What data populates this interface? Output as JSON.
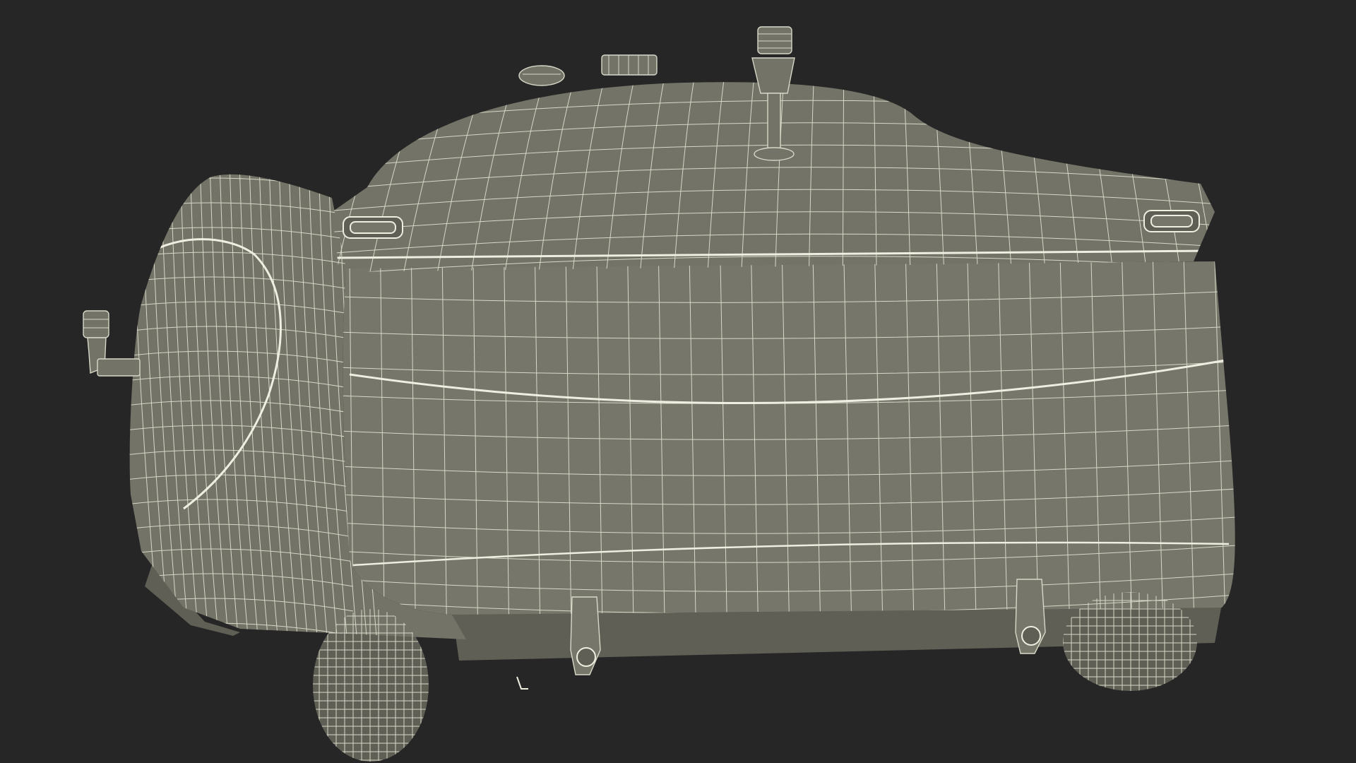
{
  "scene": {
    "subject": "wireframe-delivery-robot",
    "colors": {
      "background": "#262626",
      "body_fill": "#737367",
      "body_fill_dark": "#5f5f55",
      "panel_fill": "#76766a",
      "wire": "#d8d8c8",
      "wire_strong": "#efeee0",
      "shadow": "#3e3e38"
    }
  }
}
